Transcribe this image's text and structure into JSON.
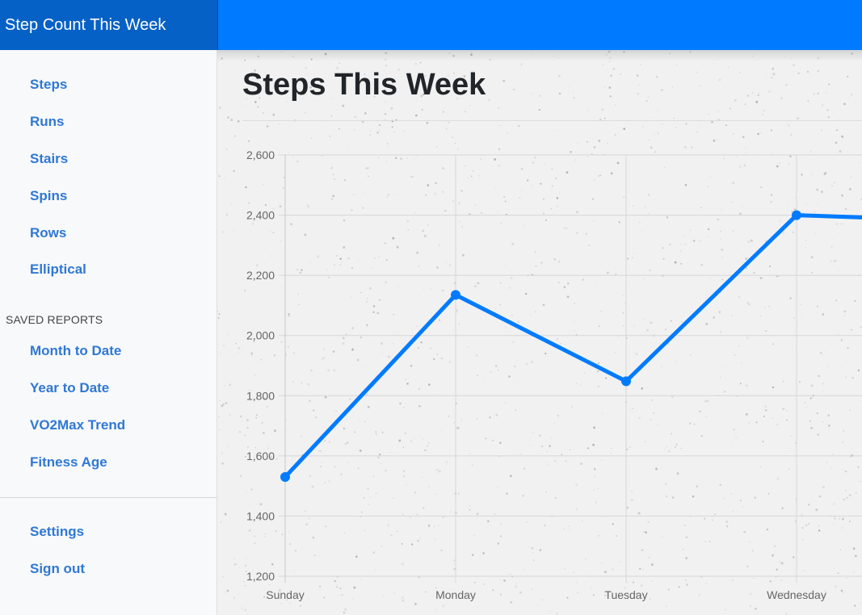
{
  "header": {
    "brand": "Step Count This Week"
  },
  "sidebar": {
    "items": [
      {
        "label": "Steps"
      },
      {
        "label": "Runs"
      },
      {
        "label": "Stairs"
      },
      {
        "label": "Spins"
      },
      {
        "label": "Rows"
      },
      {
        "label": "Elliptical"
      }
    ],
    "saved_reports_heading": "SAVED REPORTS",
    "saved_reports": [
      {
        "label": "Month to Date"
      },
      {
        "label": "Year to Date"
      },
      {
        "label": "VO2Max Trend"
      },
      {
        "label": "Fitness Age"
      }
    ],
    "footer_items": [
      {
        "label": "Settings"
      },
      {
        "label": "Sign out"
      }
    ]
  },
  "main": {
    "title": "Steps This Week"
  },
  "colors": {
    "accent": "#007bff",
    "brand_bg": "#0661c6",
    "link": "#2f78d4",
    "line": "#007bff"
  },
  "chart_data": {
    "type": "line",
    "title": "",
    "xlabel": "",
    "ylabel": "",
    "categories": [
      "Sunday",
      "Monday",
      "Tuesday",
      "Wednesday"
    ],
    "series": [
      {
        "values": [
          1530,
          2135,
          1848,
          2400
        ]
      }
    ],
    "continues_right_to": 2380,
    "ylim": [
      1200,
      2600
    ],
    "yticks": [
      "1,200",
      "1,400",
      "1,600",
      "1,800",
      "2,000",
      "2,200",
      "2,400",
      "2,600"
    ],
    "grid": true,
    "legend": "none"
  }
}
